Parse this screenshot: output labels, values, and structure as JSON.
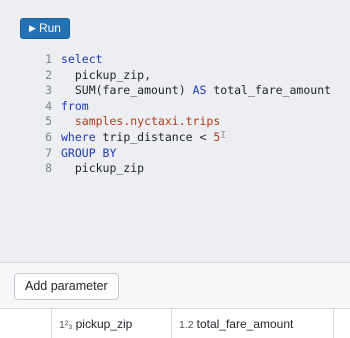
{
  "toolbar": {
    "run_icon": "play-icon",
    "run_label": "Run"
  },
  "editor": {
    "lines": [
      {
        "n": "1",
        "parts": [
          {
            "t": "select",
            "c": "kw"
          }
        ]
      },
      {
        "n": "2",
        "parts": [
          {
            "t": "  pickup_zip,",
            "c": ""
          }
        ]
      },
      {
        "n": "3",
        "parts": [
          {
            "t": "  SUM(fare_amount) ",
            "c": ""
          },
          {
            "t": "AS",
            "c": "kw"
          },
          {
            "t": " total_fare_amount",
            "c": ""
          }
        ]
      },
      {
        "n": "4",
        "parts": [
          {
            "t": "from",
            "c": "kw"
          }
        ]
      },
      {
        "n": "5",
        "parts": [
          {
            "t": "  samples.nyctaxi.trips",
            "c": "tbl"
          }
        ]
      },
      {
        "n": "6",
        "parts": [
          {
            "t": "where",
            "c": "kw"
          },
          {
            "t": " trip_distance < ",
            "c": ""
          },
          {
            "t": "5",
            "c": "num"
          }
        ]
      },
      {
        "n": "7",
        "parts": [
          {
            "t": "GROUP BY",
            "c": "kw"
          }
        ]
      },
      {
        "n": "8",
        "parts": [
          {
            "t": "  pickup_zip",
            "c": ""
          }
        ]
      }
    ]
  },
  "parameters": {
    "add_label": "Add parameter"
  },
  "results": {
    "columns": [
      {
        "type_icon": "1²₃",
        "label": "pickup_zip"
      },
      {
        "type_icon": "1.2",
        "label": "total_fare_amount"
      }
    ]
  },
  "colors": {
    "accent": "#2272b4",
    "keyword": "#1f3bb3",
    "literal": "#b33a1a"
  }
}
